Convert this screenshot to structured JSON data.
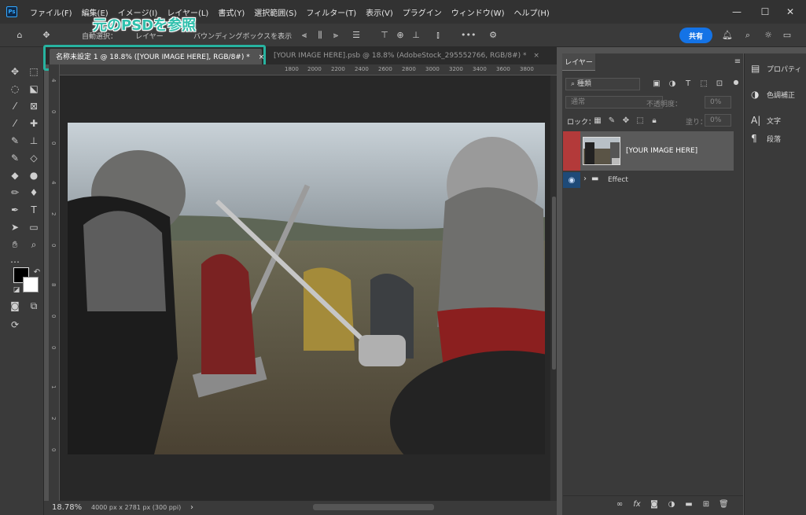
{
  "app": {
    "logo": "Ps"
  },
  "menu": [
    "ファイル(F)",
    "編集(E)",
    "イメージ(I)",
    "レイヤー(L)",
    "書式(Y)",
    "選択範囲(S)",
    "フィルター(T)",
    "表示(V)",
    "プラグイン",
    "ウィンドウ(W)",
    "ヘルプ(H)"
  ],
  "window_controls": {
    "minimize": "—",
    "maximize": "☐",
    "close": "✕"
  },
  "options": {
    "auto_select": "自動選択：",
    "layer_select": "レイヤー",
    "bounding_box": "バウンディングボックスを表示",
    "share": "共有",
    "more": "•••"
  },
  "callout": "元のPSDを参照",
  "tabs": [
    {
      "label": "名称未設定 1 @ 18.8% ([YOUR IMAGE HERE], RGB/8#) *",
      "close": "×"
    },
    {
      "label": "[YOUR IMAGE HERE].psb @ 18.8% (AdobeStock_295552766, RGB/8#) *",
      "close": "×"
    }
  ],
  "ruler_top": [
    "1800",
    "2000",
    "2200",
    "2400",
    "2600",
    "2800",
    "3000",
    "3200",
    "3400",
    "3600",
    "3800"
  ],
  "ruler_left": [
    "4",
    "0",
    "0",
    "4",
    "2",
    "0",
    "8",
    "0",
    "0",
    "1",
    "2",
    "0"
  ],
  "status": {
    "zoom": "18.78%",
    "doc_info": "4000 px x 2781 px (300 ppi)",
    "arrow": "›"
  },
  "layers_panel": {
    "title": "レイヤー",
    "filter": "種類",
    "blend_mode": "通常",
    "opacity_label": "不透明度：",
    "opacity_value": "0%",
    "lock_label": "ロック：",
    "fill_label": "塗り：",
    "fill_value": "0%",
    "layers": [
      {
        "name": "[YOUR IMAGE HERE]",
        "selected": true
      },
      {
        "name": "Effect",
        "type": "group"
      }
    ]
  },
  "right_dock": [
    {
      "label": "プロパティ",
      "icon": "properties-icon"
    },
    {
      "label": "色調補正",
      "icon": "adjustments-icon"
    },
    {
      "label": "文字",
      "icon": "character-icon"
    },
    {
      "label": "段落",
      "icon": "paragraph-icon"
    }
  ],
  "colors": {
    "accent": "#1473e6",
    "highlight": "#27b3a0",
    "layer_vis": "#b33a3a"
  }
}
